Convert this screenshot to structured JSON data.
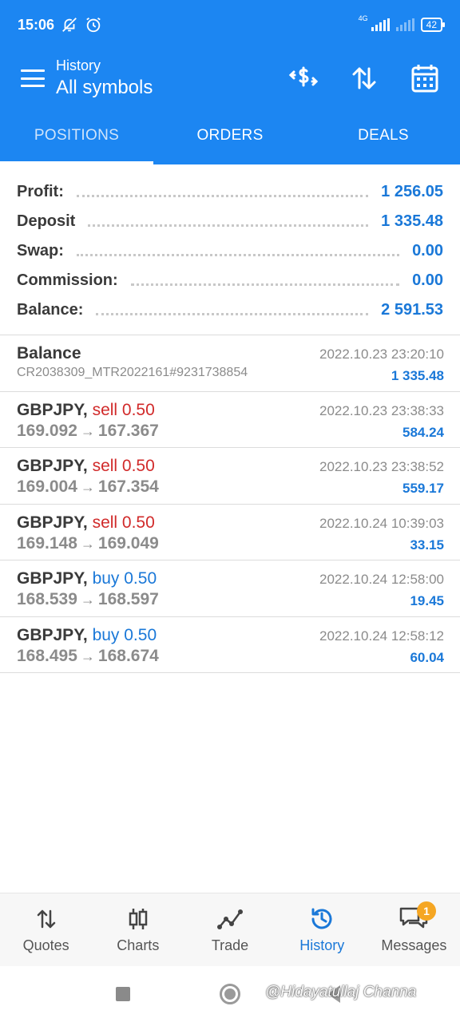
{
  "status": {
    "time": "15:06",
    "network": "4G",
    "battery": "42"
  },
  "header": {
    "subtitle": "History",
    "title": "All symbols"
  },
  "tabs": [
    {
      "label": "POSITIONS"
    },
    {
      "label": "ORDERS"
    },
    {
      "label": "DEALS"
    }
  ],
  "summary": [
    {
      "label": "Profit:",
      "value": "1 256.05"
    },
    {
      "label": "Deposit",
      "value": "1 335.48"
    },
    {
      "label": "Swap:",
      "value": "0.00"
    },
    {
      "label": "Commission:",
      "value": "0.00"
    },
    {
      "label": "Balance:",
      "value": "2 591.53"
    }
  ],
  "balance_entry": {
    "title": "Balance",
    "reference": "CR2038309_MTR2022161#9231738854",
    "time": "2022.10.23 23:20:10",
    "amount": "1 335.48"
  },
  "deals": [
    {
      "symbol": "GBPJPY,",
      "side": "sell 0.50",
      "open": "169.092",
      "close": "167.367",
      "time": "2022.10.23 23:38:33",
      "profit": "584.24",
      "type": "sell"
    },
    {
      "symbol": "GBPJPY,",
      "side": "sell 0.50",
      "open": "169.004",
      "close": "167.354",
      "time": "2022.10.23 23:38:52",
      "profit": "559.17",
      "type": "sell"
    },
    {
      "symbol": "GBPJPY,",
      "side": "sell 0.50",
      "open": "169.148",
      "close": "169.049",
      "time": "2022.10.24 10:39:03",
      "profit": "33.15",
      "type": "sell"
    },
    {
      "symbol": "GBPJPY,",
      "side": "buy 0.50",
      "open": "168.539",
      "close": "168.597",
      "time": "2022.10.24 12:58:00",
      "profit": "19.45",
      "type": "buy"
    },
    {
      "symbol": "GBPJPY,",
      "side": "buy 0.50",
      "open": "168.495",
      "close": "168.674",
      "time": "2022.10.24 12:58:12",
      "profit": "60.04",
      "type": "buy"
    }
  ],
  "arrow": "→",
  "bottom_nav": [
    {
      "label": "Quotes",
      "icon": "quotes-icon"
    },
    {
      "label": "Charts",
      "icon": "charts-icon"
    },
    {
      "label": "Trade",
      "icon": "trade-icon"
    },
    {
      "label": "History",
      "icon": "history-icon"
    },
    {
      "label": "Messages",
      "icon": "messages-icon",
      "badge": "1"
    }
  ],
  "watermark": "@Hidayatullaj Channa",
  "colors": {
    "brand": "#1c86f2",
    "profit": "#1a78d8",
    "sell": "#d12a2a"
  }
}
